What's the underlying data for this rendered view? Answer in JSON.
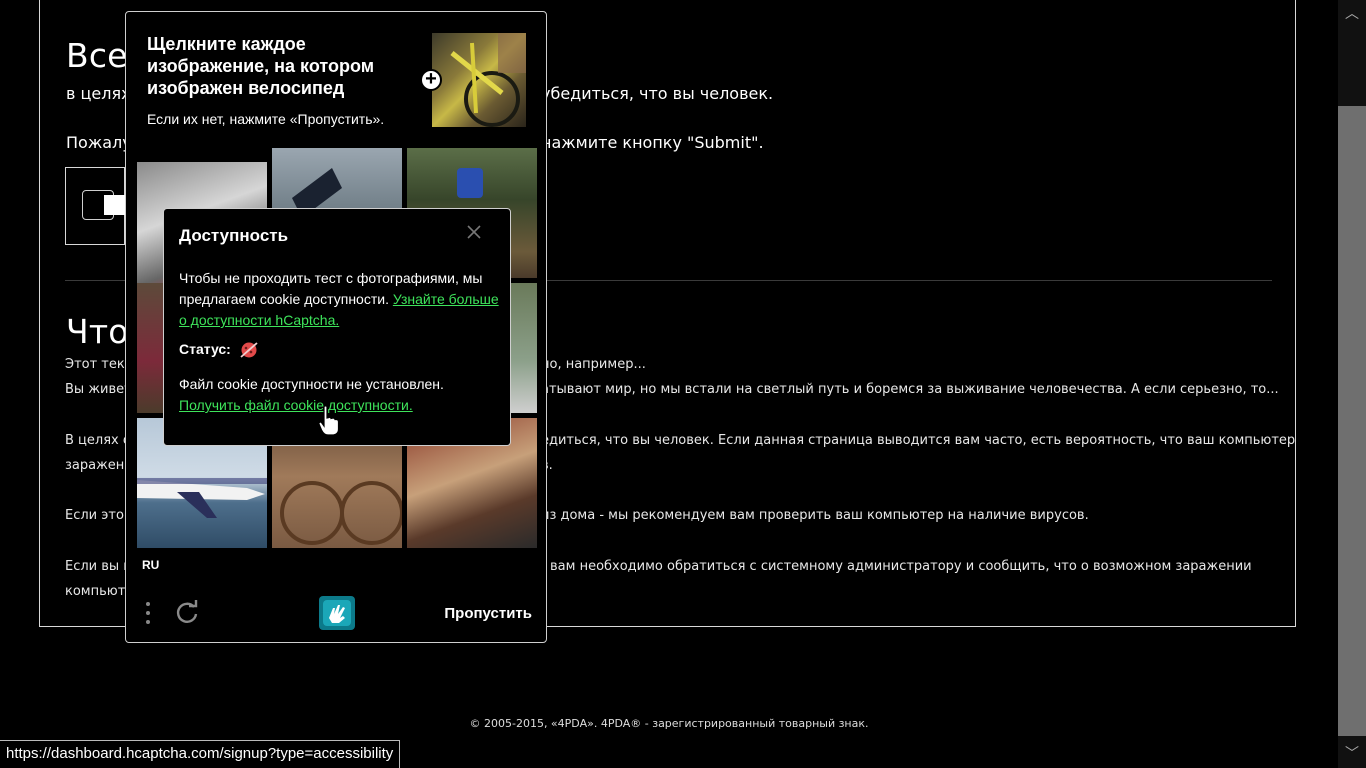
{
  "page": {
    "heading1": "Все",
    "line1_left": "в целях",
    "line1_right": "убедиться, что вы человек.",
    "line2_left": "Пожалу",
    "line2_right": "нажмите кнопку \"Submit\".",
    "heading2": "Что",
    "para1_left": "Этот текс",
    "para1_right": "но, например...",
    "para2_left": "Вы живет",
    "para2_right": "атывают мир, но мы встали на светлый путь и боремся за выживание человечества. А если серьезно, то...",
    "para3_left": "В целях о",
    "para3_right": "едиться, что вы человек. Если данная страница выводится вам часто, есть вероятность, что ваш компьютер",
    "para4_left": "заражен",
    "para4_right": "в.",
    "para5_left": "Если это в",
    "para5_right": "из дома - мы рекомендуем вам проверить ваш компьютер на наличие вирусов.",
    "para6_left": "Если вы п",
    "para6_right": "вам необходимо обратиться с системному администратору и сообщить, что о возможном заражении",
    "para7_left": "компьюте",
    "footer": "© 2005-2015, «4PDA». 4PDA® - зарегистрированный товарный знак."
  },
  "captcha": {
    "title": "Щелкните каждое изображение, на котором изображен велосипед",
    "subtitle": "Если их нет, нажмите «Пропустить».",
    "language": "RU",
    "skip_label": "Пропустить",
    "menu_icon": "more-vertical-icon",
    "refresh_icon": "refresh-icon",
    "logo_icon": "hcaptcha-logo-icon"
  },
  "accessibility": {
    "title": "Доступность",
    "body_text": "Чтобы не проходить тест с фотографиями, мы предлагаем cookie доступности.",
    "learn_more_link": "Узнайте больше о доступности hCaptcha.",
    "status_label": "Статус:",
    "cookie_text": "Файл cookie доступности не установлен.",
    "get_cookie_link": "Получить файл cookie доступности.",
    "link_color": "#3ee45b"
  },
  "status_bar": {
    "url": "https://dashboard.hcaptcha.com/signup?type=accessibility"
  }
}
